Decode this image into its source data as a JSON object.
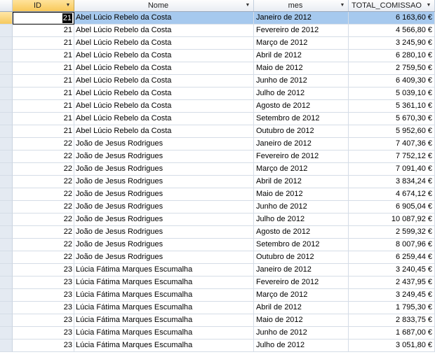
{
  "columns": {
    "id": "ID",
    "nome": "Nome",
    "mes": "mes",
    "total": "TOTAL_COMISSAO"
  },
  "dropdown_icon": "chevron-down-icon",
  "colors": {
    "current_row_highlight": "#a6c9ee",
    "active_header": "#f8c85a",
    "gridline": "#d5dde7"
  },
  "rows": [
    {
      "id": "21",
      "nome": "Abel Lúcio Rebelo da Costa",
      "mes": "Janeiro de 2012",
      "total": "6 163,60 €"
    },
    {
      "id": "21",
      "nome": "Abel Lúcio Rebelo da Costa",
      "mes": "Fevereiro de 2012",
      "total": "4 566,80 €"
    },
    {
      "id": "21",
      "nome": "Abel Lúcio Rebelo da Costa",
      "mes": "Março de 2012",
      "total": "3 245,90 €"
    },
    {
      "id": "21",
      "nome": "Abel Lúcio Rebelo da Costa",
      "mes": "Abril de 2012",
      "total": "6 280,10 €"
    },
    {
      "id": "21",
      "nome": "Abel Lúcio Rebelo da Costa",
      "mes": "Maio de 2012",
      "total": "2 759,50 €"
    },
    {
      "id": "21",
      "nome": "Abel Lúcio Rebelo da Costa",
      "mes": "Junho de 2012",
      "total": "6 409,30 €"
    },
    {
      "id": "21",
      "nome": "Abel Lúcio Rebelo da Costa",
      "mes": "Julho de 2012",
      "total": "5 039,10 €"
    },
    {
      "id": "21",
      "nome": "Abel Lúcio Rebelo da Costa",
      "mes": "Agosto de 2012",
      "total": "5 361,10 €"
    },
    {
      "id": "21",
      "nome": "Abel Lúcio Rebelo da Costa",
      "mes": "Setembro de 2012",
      "total": "5 670,30 €"
    },
    {
      "id": "21",
      "nome": "Abel Lúcio Rebelo da Costa",
      "mes": "Outubro de 2012",
      "total": "5 952,60 €"
    },
    {
      "id": "22",
      "nome": "João de Jesus Rodrigues",
      "mes": "Janeiro de 2012",
      "total": "7 407,36 €"
    },
    {
      "id": "22",
      "nome": "João de Jesus Rodrigues",
      "mes": "Fevereiro de 2012",
      "total": "7 752,12 €"
    },
    {
      "id": "22",
      "nome": "João de Jesus Rodrigues",
      "mes": "Março de 2012",
      "total": "7 091,40 €"
    },
    {
      "id": "22",
      "nome": "João de Jesus Rodrigues",
      "mes": "Abril de 2012",
      "total": "3 834,24 €"
    },
    {
      "id": "22",
      "nome": "João de Jesus Rodrigues",
      "mes": "Maio de 2012",
      "total": "4 674,12 €"
    },
    {
      "id": "22",
      "nome": "João de Jesus Rodrigues",
      "mes": "Junho de 2012",
      "total": "6 905,04 €"
    },
    {
      "id": "22",
      "nome": "João de Jesus Rodrigues",
      "mes": "Julho de 2012",
      "total": "10 087,92 €"
    },
    {
      "id": "22",
      "nome": "João de Jesus Rodrigues",
      "mes": "Agosto de 2012",
      "total": "2 599,32 €"
    },
    {
      "id": "22",
      "nome": "João de Jesus Rodrigues",
      "mes": "Setembro de 2012",
      "total": "8 007,96 €"
    },
    {
      "id": "22",
      "nome": "João de Jesus Rodrigues",
      "mes": "Outubro de 2012",
      "total": "6 259,44 €"
    },
    {
      "id": "23",
      "nome": "Lúcia Fátima Marques Escumalha",
      "mes": "Janeiro de 2012",
      "total": "3 240,45 €"
    },
    {
      "id": "23",
      "nome": "Lúcia Fátima Marques Escumalha",
      "mes": "Fevereiro de 2012",
      "total": "2 437,95 €"
    },
    {
      "id": "23",
      "nome": "Lúcia Fátima Marques Escumalha",
      "mes": "Março de 2012",
      "total": "3 249,45 €"
    },
    {
      "id": "23",
      "nome": "Lúcia Fátima Marques Escumalha",
      "mes": "Abril de 2012",
      "total": "1 795,30 €"
    },
    {
      "id": "23",
      "nome": "Lúcia Fátima Marques Escumalha",
      "mes": "Maio de 2012",
      "total": "2 833,75 €"
    },
    {
      "id": "23",
      "nome": "Lúcia Fátima Marques Escumalha",
      "mes": "Junho de 2012",
      "total": "1 687,00 €"
    },
    {
      "id": "23",
      "nome": "Lúcia Fátima Marques Escumalha",
      "mes": "Julho de 2012",
      "total": "3 051,80 €"
    }
  ]
}
